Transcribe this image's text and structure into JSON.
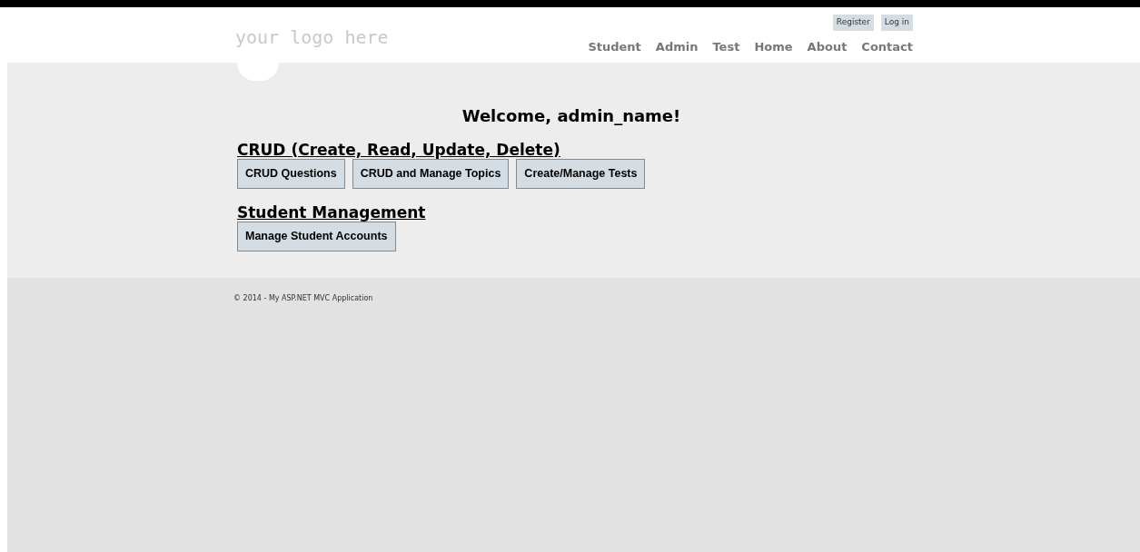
{
  "header": {
    "logo": "your logo here",
    "login_links": [
      "Register",
      "Log in"
    ],
    "nav": [
      {
        "label": "Student"
      },
      {
        "label": "Admin"
      },
      {
        "label": "Test"
      },
      {
        "label": "Home"
      },
      {
        "label": "About"
      },
      {
        "label": "Contact"
      }
    ]
  },
  "main": {
    "title": "Welcome, admin_name!",
    "sections": [
      {
        "heading": "CRUD (Create, Read, Update, Delete)",
        "buttons": [
          "CRUD Questions",
          "CRUD and Manage Topics",
          "Create/Manage Tests"
        ]
      },
      {
        "heading": "Student Management",
        "buttons": [
          "Manage Student Accounts"
        ]
      }
    ]
  },
  "footer": {
    "text": "© 2014 - My ASP.NET MVC Application"
  }
}
